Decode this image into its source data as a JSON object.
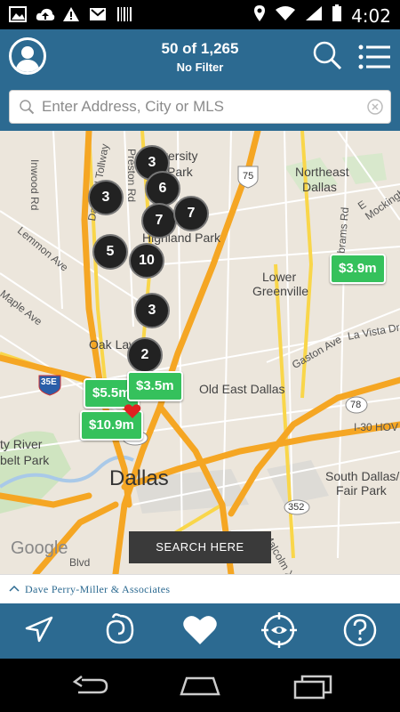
{
  "status_bar": {
    "time": "4:02"
  },
  "header": {
    "title": "50 of 1,265",
    "subtitle": "No Filter"
  },
  "search": {
    "placeholder": "Enter Address, City or MLS"
  },
  "map": {
    "clusters": [
      "3",
      "6",
      "3",
      "7",
      "7",
      "5",
      "10",
      "3",
      "2"
    ],
    "prices": [
      "$3.9m",
      "$5.5m",
      "$3.5m",
      "$10.9m"
    ],
    "labels": {
      "university_park_1": "versity",
      "university_park_2": "Park",
      "highland_park": "Highland Park",
      "northeast_dallas_1": "Northeast",
      "northeast_dallas_2": "Dallas",
      "lower_greenville_1": "Lower",
      "lower_greenville_2": "Greenville",
      "oak_lawn": "Oak Lawn",
      "old_east_dallas": "Old East Dallas",
      "dallas": "Dallas",
      "south_dallas_1": "South Dallas/",
      "south_dallas_2": "Fair Park",
      "trinity_1": "ty River",
      "trinity_2": "belt Park",
      "inwood": "Inwood Rd",
      "preston": "Preston Rd",
      "tollway": "Dallas N Tollway",
      "lemmon": "Lemmon Ave",
      "maple": "Maple Ave",
      "abrams": "Abrams Rd",
      "la_vista": "La Vista Dr",
      "gaston": "Gaston Ave",
      "mockingbird": "E Mockingbird",
      "i30": "I-30 HOV",
      "malcolm": "Malcolm X Blvd",
      "blvd": "Blvd",
      "hwy_75": "75",
      "hwy_35e": "35E",
      "hwy_366": "366",
      "hwy_78": "78",
      "hwy_352": "352"
    },
    "google": "Google",
    "search_here": "SEARCH HERE"
  },
  "brand": {
    "text": "Dave Perry-Miller & Associates"
  },
  "tabs": [
    {
      "name": "navigate-icon"
    },
    {
      "name": "draw-lasso-icon"
    },
    {
      "name": "heart-icon"
    },
    {
      "name": "open-house-eye-icon"
    },
    {
      "name": "help-icon"
    }
  ],
  "colors": {
    "header": "#2c6a91",
    "price_pin": "#35c15c",
    "cluster": "#222222",
    "highway": "#f5a623",
    "road": "#f9d64a"
  }
}
